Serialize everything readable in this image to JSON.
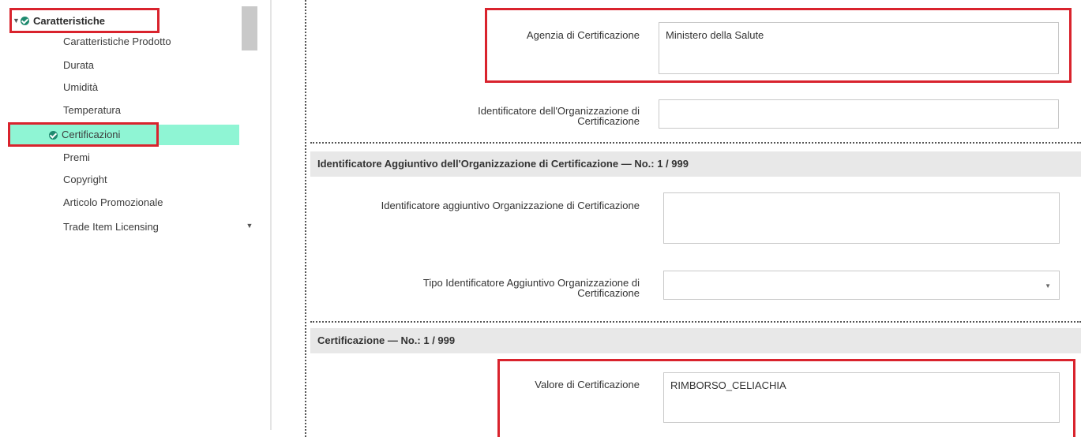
{
  "sidebar": {
    "root_label": "Caratteristiche",
    "items": [
      {
        "label": "Caratteristiche Prodotto"
      },
      {
        "label": "Durata"
      },
      {
        "label": "Umidità"
      },
      {
        "label": "Temperatura"
      },
      {
        "label": "Certificazioni"
      },
      {
        "label": "Premi"
      },
      {
        "label": "Copyright"
      },
      {
        "label": "Articolo Promozionale"
      },
      {
        "label": "Trade Item Licensing"
      }
    ]
  },
  "form": {
    "agenzia_label": "Agenzia di Certificazione",
    "agenzia_value": "Ministero della Salute",
    "identificatore_org_label": "Identificatore dell'Organizzazione di Certificazione",
    "identificatore_org_value": "",
    "section_aggiuntivo": "Identificatore Aggiuntivo dell'Organizzazione di Certificazione — No.: 1 / 999",
    "id_aggiuntivo_label": "Identificatore aggiuntivo Organizzazione di Certificazione",
    "id_aggiuntivo_value": "",
    "tipo_id_label": "Tipo Identificatore Aggiuntivo Organizzazione di Certificazione",
    "tipo_id_value": "",
    "section_certificazione": "Certificazione — No.: 1 / 999",
    "valore_label": "Valore di Certificazione",
    "valore_value": "RIMBORSO_CELIACHIA"
  },
  "colors": {
    "highlight_box": "#d9232d",
    "active_item_bg": "#8ff5d4",
    "check_icon": "#1e8a6f",
    "section_bg": "#e8e8e8"
  }
}
